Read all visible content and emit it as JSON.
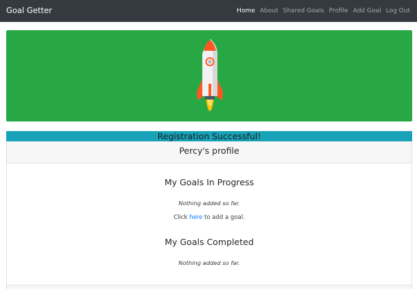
{
  "navbar": {
    "brand": "Goal Getter",
    "links": [
      "Home",
      "About",
      "Shared Goals",
      "Profile",
      "Add Goal",
      "Log Out"
    ],
    "active": "Home"
  },
  "hero": {
    "image": "rocket-icon",
    "color": "#28a745"
  },
  "alert": {
    "text": "Registration Successful!",
    "color": "#17a2b8"
  },
  "profile": {
    "header": "Percy's profile",
    "in_progress_title": "My Goals In Progress",
    "in_progress_empty": "Nothing added so far.",
    "click_prefix": "Click ",
    "click_link": "here",
    "click_suffix": " to add a goal.",
    "completed_title": "My Goals Completed",
    "completed_empty": "Nothing added so far."
  }
}
